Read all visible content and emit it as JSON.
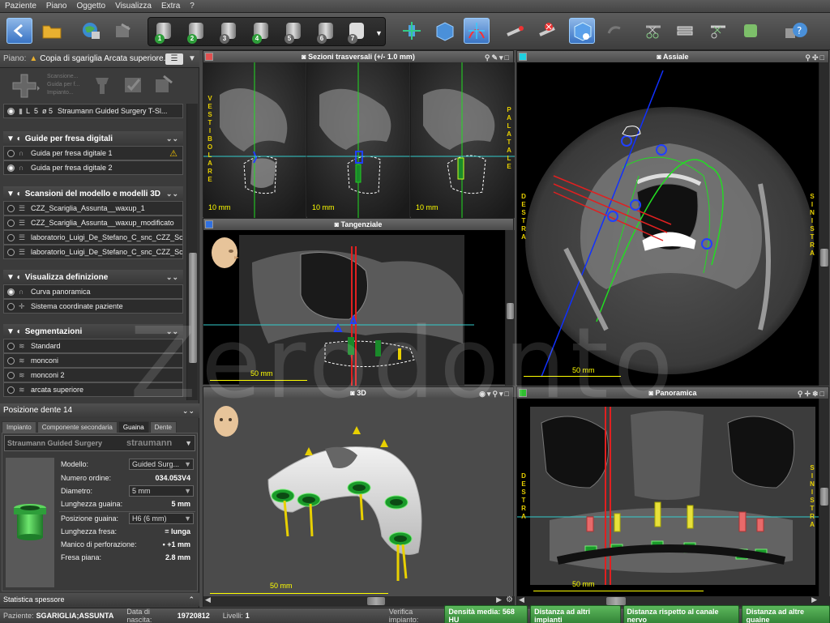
{
  "menu": [
    "Paziente",
    "Piano",
    "Oggetto",
    "Visualizza",
    "Extra",
    "?"
  ],
  "plan": {
    "label": "Piano:",
    "name": "Copia di sgariglia Arcata superiore..."
  },
  "plan_tools": [
    "Scansione...",
    "Guida per f...",
    "Impianto..."
  ],
  "implant_row": {
    "pos": "L",
    "num": "5",
    "dia": "ø 5",
    "name": "Straumann Guided Surgery T-Sl..."
  },
  "sections": {
    "guides": {
      "title": "Guide per fresa digitali",
      "items": [
        "Guida per fresa digitale 1",
        "Guida per fresa digitale 2"
      ]
    },
    "scans": {
      "title": "Scansioni del modello e modelli 3D",
      "items": [
        "CZZ_Scariglia_Assunta__waxup_1",
        "CZZ_Scariglia_Assunta__waxup_modificato",
        "laboratorio_Luigi_De_Stefano_C_snc_CZZ_Sc...",
        "laboratorio_Luigi_De_Stefano_C_snc_CZZ_Sc..."
      ]
    },
    "views": {
      "title": "Visualizza definizione",
      "items": [
        "Curva panoramica",
        "Sistema coordinate paziente"
      ]
    },
    "segm": {
      "title": "Segmentazioni",
      "items": [
        "Standard",
        "monconi",
        "monconi 2",
        "arcata superiore"
      ]
    }
  },
  "tooth": {
    "header": "Posizione dente 14",
    "tabs": [
      "Impianto",
      "Componente secondaria",
      "Guaina",
      "Dente"
    ],
    "vendor": "Straumann Guided Surgery",
    "vendor_logo": "straumann",
    "props": [
      {
        "label": "Modello:",
        "value": "Guided Surg..."
      },
      {
        "label": "Numero ordine:",
        "value": "034.053V4"
      },
      {
        "label": "Diametro:",
        "value": "5 mm"
      },
      {
        "label": "Lunghezza guaina:",
        "value": "5 mm"
      },
      {
        "label": "Posizione guaina:",
        "value": "H6 (6 mm)"
      },
      {
        "label": "Lunghezza fresa:",
        "value": "= lunga"
      },
      {
        "label": "Manico di perforazione:",
        "value": "• +1 mm"
      },
      {
        "label": "Fresa piana:",
        "value": "2.8 mm"
      }
    ],
    "footer": "Statistica spessore"
  },
  "views": {
    "cross": {
      "title": "Sezioni trasversali (+/- 1.0 mm)",
      "scale": "10 mm",
      "left_label": "VESTIBOLARE",
      "right_label": "PALATALE"
    },
    "axial": {
      "title": "Assiale",
      "scale": "50 mm",
      "left_label": "DESTRA",
      "right_label": "SINISTRA"
    },
    "tang": {
      "title": "Tangenziale",
      "scale": "50 mm"
    },
    "three": {
      "title": "3D",
      "scale": "50 mm"
    },
    "pano": {
      "title": "Panoramica",
      "scale": "50 mm",
      "left_label": "DESTRA",
      "right_label": "SINISTRA"
    }
  },
  "watermark": "Zerodonto",
  "status": {
    "patient_label": "Paziente:",
    "patient": "SGARIGLIA;ASSUNTA",
    "dob_label": "Data di nascita:",
    "dob": "19720812",
    "levels_label": "Livelli:",
    "levels": "1",
    "verify": "Verifica impianto:",
    "badges": [
      "Densità media: 568 HU",
      "Distanza ad altri impianti",
      "Distanza rispetto al canale nervo",
      "Distanza ad altre guaine"
    ]
  },
  "colors": {
    "accent": "#3a74c4",
    "ok": "#2e7d32",
    "yellow": "#e8d000",
    "guide": "#1030ff"
  }
}
